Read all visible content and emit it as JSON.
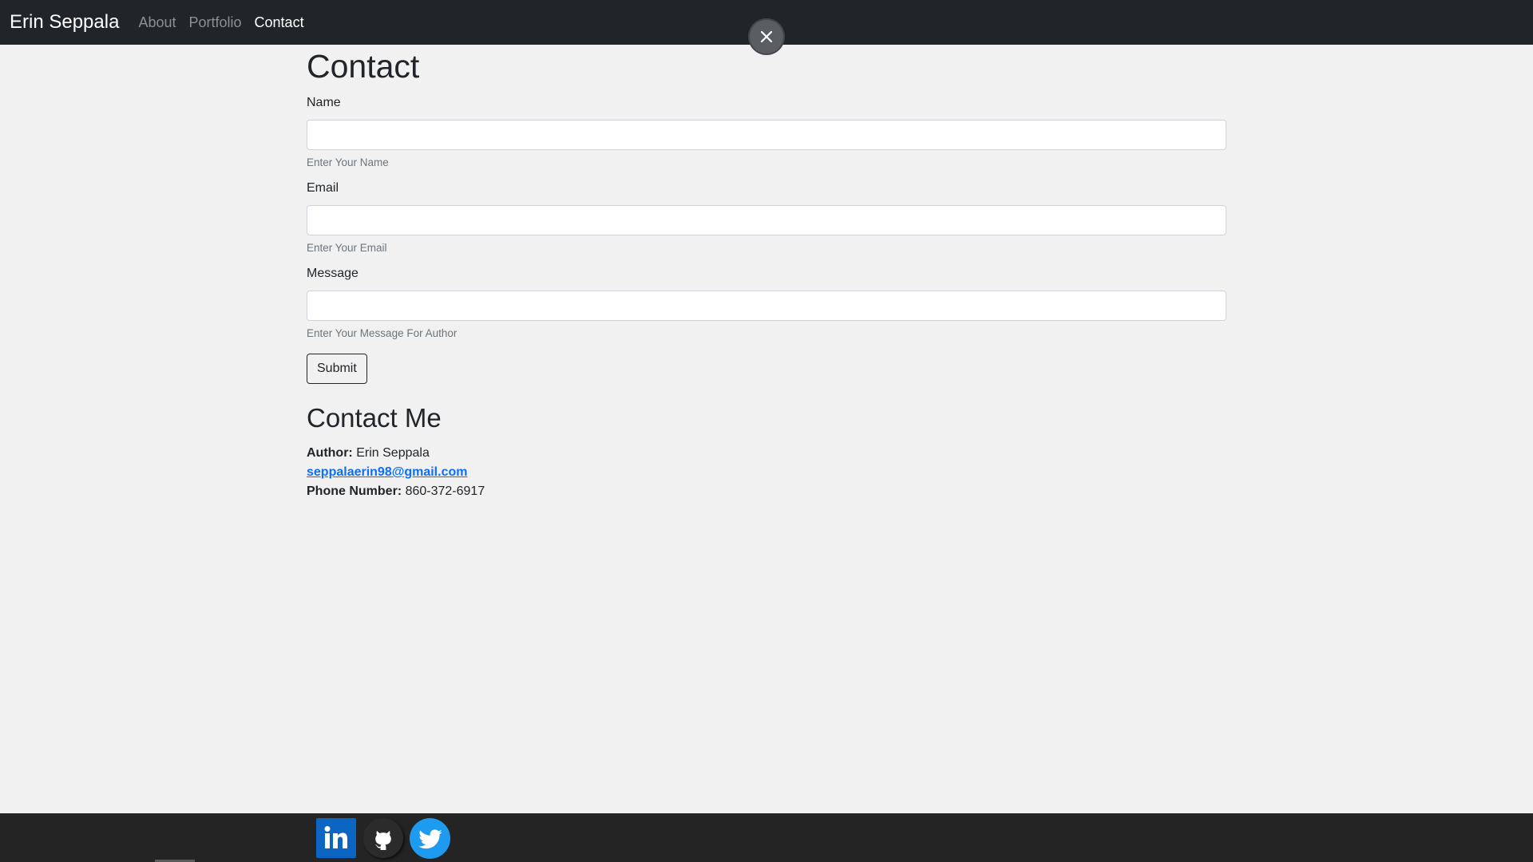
{
  "navbar": {
    "brand": "Erin Seppala",
    "links": [
      {
        "label": "About",
        "active": false
      },
      {
        "label": "Portfolio",
        "active": false
      },
      {
        "label": "Contact",
        "active": true
      }
    ]
  },
  "overlay": {
    "close_icon": "close-icon"
  },
  "contact_form": {
    "title": "Contact",
    "fields": [
      {
        "label": "Name",
        "value": "",
        "hint": "Enter Your Name"
      },
      {
        "label": "Email",
        "value": "",
        "hint": "Enter Your Email"
      },
      {
        "label": "Message",
        "value": "",
        "hint": "Enter Your Message For Author"
      }
    ],
    "submit_label": "Submit"
  },
  "contact_me": {
    "title": "Contact Me",
    "author_label": "Author:",
    "author_name": "Erin Seppala",
    "email": "seppalaerin98@gmail.com",
    "phone_label": "Phone Number:",
    "phone": "860-372-6917"
  },
  "footer": {
    "social": [
      {
        "name": "linkedin-icon",
        "color": "#0a66c2"
      },
      {
        "name": "github-icon",
        "color": "#2b2b2b"
      },
      {
        "name": "twitter-icon",
        "color": "#1d9bf0"
      }
    ]
  },
  "colors": {
    "navbar_bg": "#212529",
    "page_bg": "#f1f1f1",
    "link_blue": "#0d6efd",
    "footer_bg": "#242424"
  }
}
